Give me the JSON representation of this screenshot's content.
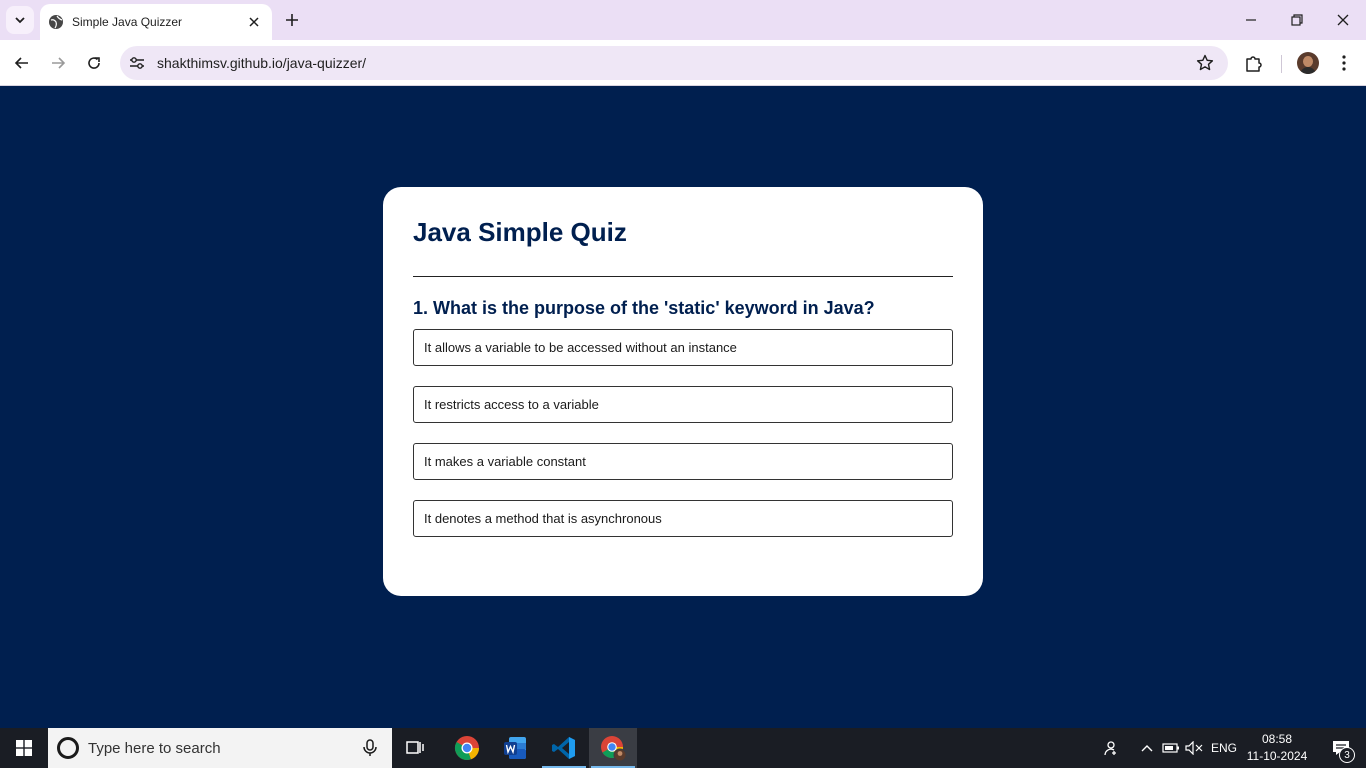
{
  "browser": {
    "tab_title": "Simple Java Quizzer",
    "url": "shakthimsv.github.io/java-quizzer/"
  },
  "quiz": {
    "title": "Java Simple Quiz",
    "question": "1. What is the purpose of the 'static' keyword in Java?",
    "answers": [
      "It allows a variable to be accessed without an instance",
      "It restricts access to a variable",
      "It makes a variable constant",
      "It denotes a method that is asynchronous"
    ]
  },
  "taskbar": {
    "search_placeholder": "Type here to search",
    "language": "ENG",
    "time": "08:58",
    "date": "11-10-2024",
    "notification_count": "3"
  },
  "colors": {
    "page_background": "#001f4f",
    "card_background": "#ffffff",
    "tabstrip": "#ebdff5"
  }
}
